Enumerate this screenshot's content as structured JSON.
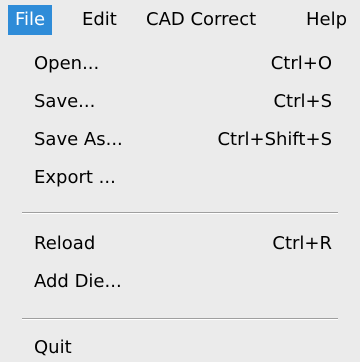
{
  "menubar": {
    "items": [
      {
        "label": "File"
      },
      {
        "label": "Edit"
      },
      {
        "label": "CAD Correct"
      },
      {
        "label": "Help"
      }
    ]
  },
  "file_menu": {
    "items": [
      {
        "label": "Open...",
        "shortcut": "Ctrl+O"
      },
      {
        "label": "Save...",
        "shortcut": "Ctrl+S"
      },
      {
        "label": "Save As...",
        "shortcut": "Ctrl+Shift+S"
      },
      {
        "label": "Export ...",
        "shortcut": ""
      },
      {
        "label": "Reload",
        "shortcut": "Ctrl+R"
      },
      {
        "label": "Add Die...",
        "shortcut": ""
      },
      {
        "label": "Quit",
        "shortcut": ""
      }
    ]
  },
  "colors": {
    "active_menu_bg": "#2f8cd8",
    "menu_bg": "#ebebeb",
    "separator": "#9f9f9f"
  }
}
